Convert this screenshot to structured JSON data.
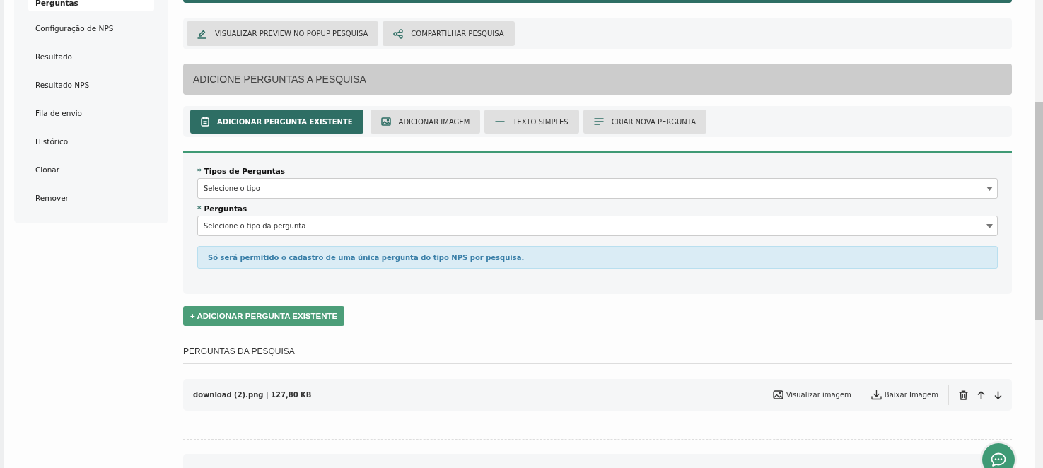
{
  "sidebar": {
    "items": [
      {
        "label": "Perguntas",
        "selected": true
      },
      {
        "label": "Configuração de NPS",
        "selected": false
      },
      {
        "label": "Resultado",
        "selected": false
      },
      {
        "label": "Resultado NPS",
        "selected": false
      },
      {
        "label": "Fila de envio",
        "selected": false
      },
      {
        "label": "Histórico",
        "selected": false
      },
      {
        "label": "Clonar",
        "selected": false
      },
      {
        "label": "Remover",
        "selected": false
      }
    ]
  },
  "toolbar": {
    "buttons": [
      {
        "label": "VISUALIZAR PREVIEW NO POPUP PESQUISA",
        "kind": "preview"
      },
      {
        "label": "COMPARTILHAR PESQUISA",
        "kind": "share"
      }
    ]
  },
  "section_header": "ADICIONE PERGUNTAS A PESQUISA",
  "tabs": [
    {
      "label": "ADICIONAR PERGUNTA EXISTENTE",
      "kind": "existing",
      "selected": true
    },
    {
      "label": "ADICIONAR IMAGEM",
      "kind": "image",
      "selected": false
    },
    {
      "label": "TEXTO SIMPLES",
      "kind": "text",
      "selected": false
    },
    {
      "label": "CRIAR NOVA PERGUNTA",
      "kind": "new",
      "selected": false
    }
  ],
  "form": {
    "fields": [
      {
        "required_mark": "*",
        "label": "Tipos de Perguntas",
        "placeholder": "Selecione o tipo"
      },
      {
        "required_mark": "*",
        "label": "Perguntas",
        "placeholder": "Selecione o tipo da pergunta"
      }
    ],
    "alert": "Só será permitido o cadastro de uma única pergunta do tipo NPS por pesquisa."
  },
  "add_button": "+ ADICIONAR PERGUNTA EXISTENTE",
  "questions": {
    "title": "PERGUNTAS DA PESQUISA",
    "items": [
      {
        "name": "download (2).png | 127,80 KB",
        "actions": [
          {
            "label": "Visualizar imagem",
            "kind": "view"
          },
          {
            "label": "Baixar Imagem",
            "kind": "download"
          }
        ]
      }
    ]
  }
}
